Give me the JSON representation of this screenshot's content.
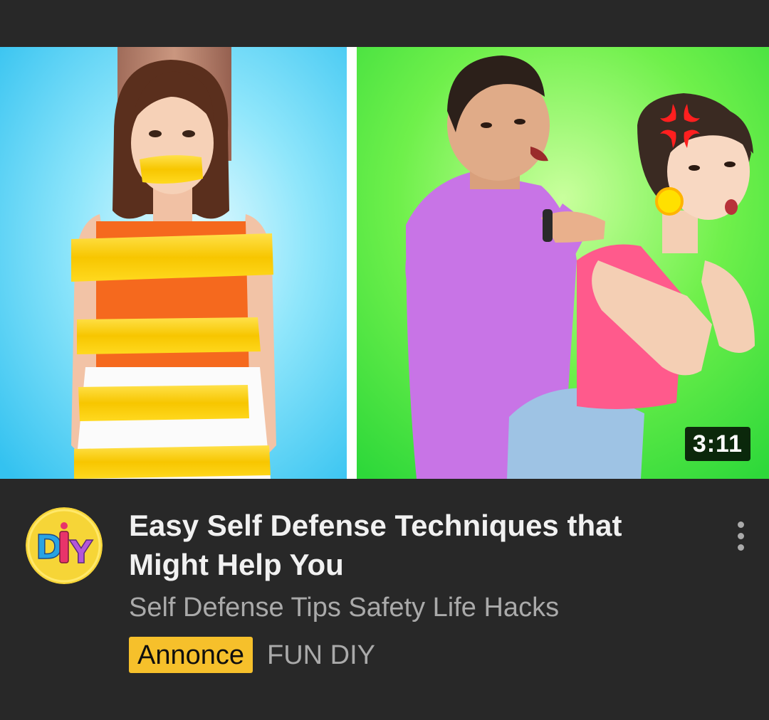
{
  "video": {
    "title": "Easy Self Defense Techniques that Might Help You",
    "subtitle": "Self Defense Tips Safety Life Hacks",
    "duration": "3:11",
    "ad_label": "Annonce",
    "channel": "FUN DIY"
  },
  "avatar": {
    "logo_text": "DIY"
  },
  "icons": {
    "menu": "more-vert-icon",
    "angry": "angry-vein-icon"
  },
  "colors": {
    "background": "#282828",
    "badge": "#f6c02b",
    "secondary_text": "#aaaaaa",
    "title_text": "#f1f1f1"
  }
}
